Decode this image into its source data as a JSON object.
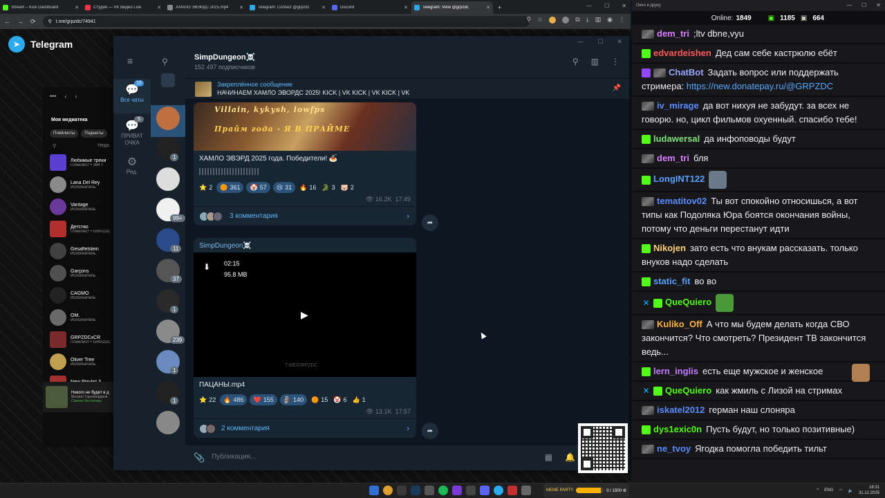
{
  "browser": {
    "tabs": [
      {
        "title": "Stream – Kick Dashboard",
        "color": "#53fc18"
      },
      {
        "title": "Студия — VK Видео Live",
        "color": "#ff3347"
      },
      {
        "title": "ХАМЛО ЭВЭРДС 2025.mp4",
        "color": "#888888"
      },
      {
        "title": "Telegram: Contact @grpzdc",
        "color": "#2aabee"
      },
      {
        "title": "Discord",
        "color": "#5865f2"
      },
      {
        "title": "Telegram: View @grpzdc",
        "color": "#2aabee"
      }
    ],
    "url": "t.me/grpzdc/74941",
    "new_tab": "+"
  },
  "tgweb": {
    "title": "Telegram",
    "library_title": "Моя медиатека",
    "chips": [
      "Плейлисты",
      "Подкасты"
    ],
    "search_hint": "Неда",
    "playlists": [
      {
        "name": "Любимые треки",
        "sub": "Плейлист • 364 т",
        "color": "#5a3fd0"
      },
      {
        "name": "Lana Del Rey",
        "sub": "Исполнитель",
        "color": "#8a8a8a"
      },
      {
        "name": "Vantage",
        "sub": "Исполнитель",
        "color": "#6a3a9a"
      },
      {
        "name": "Детство",
        "sub": "Плейлист • GRPZDC",
        "color": "#b03030"
      },
      {
        "name": "Gesaffelstein",
        "sub": "Исполнитель",
        "color": "#404040"
      },
      {
        "name": "Garçons",
        "sub": "Исполнитель",
        "color": "#505050"
      },
      {
        "name": "CAGMO",
        "sub": "Исполнитель",
        "color": "#222222"
      },
      {
        "name": "OM.",
        "sub": "Исполнитель",
        "color": "#6a6a6a"
      },
      {
        "name": "GRPZDCxCR",
        "sub": "Плейлист • GRPZDC",
        "color": "#7a2a2a"
      },
      {
        "name": "Oliver Tree",
        "sub": "Исполнитель",
        "color": "#c0a050"
      },
      {
        "name": "New Playlist 3",
        "sub": "Плейлист • GRPZDC",
        "color": "#a03030"
      }
    ],
    "player": {
      "title": "Никого не будет в д",
      "artist": "Михаил Тарнавердиев",
      "note": "Сжатие без потерь"
    }
  },
  "tg": {
    "folders": [
      {
        "label": "Все чаты",
        "badge": "15"
      },
      {
        "label": "ПРИВАТ ОЧКА",
        "badge": "5"
      },
      {
        "label": "Ред.",
        "badge": ""
      }
    ],
    "chat_badges": [
      "1",
      "99+",
      "11",
      "37",
      "1",
      "239",
      "1",
      "1"
    ],
    "channel_name": "SimpDungeon☠️",
    "subscribers": "152 497 подписчиков",
    "pinned_label": "Закреплённое сообщение",
    "pinned_text": "НАЧИНАЕМ ХАМЛО ЭВОРДС 2025!  KICK | VK KICK | VK KICK | VK",
    "post1": {
      "image_line1": "Villain, kykysh, lowfps",
      "image_line2": "Прайм года - Я В ПРАЙМЕ",
      "text": "ХАМЛО ЭВЭРД 2025 года. Победители! 🍝",
      "reactions": [
        {
          "e": "⭐",
          "n": "2",
          "plain": true
        },
        {
          "e": "🟠",
          "n": "361"
        },
        {
          "e": "🤡",
          "n": "57"
        },
        {
          "e": "😢",
          "n": "31"
        },
        {
          "e": "🔥",
          "n": "16",
          "plain": true
        },
        {
          "e": "🐊",
          "n": "3",
          "plain": true
        },
        {
          "e": "🐷",
          "n": "2",
          "plain": true
        }
      ],
      "views": "👁 16.2K",
      "time": "17:49",
      "comments": "3 комментария"
    },
    "post2": {
      "sender": "SimpDungeon☠️",
      "duration": "02:15",
      "size": "95.8 MB",
      "watermark": "T.ME/GRPZDC",
      "text": "ПАЦАНЫ.mp4",
      "reactions": [
        {
          "e": "⭐",
          "n": "22",
          "plain": true
        },
        {
          "e": "🔥",
          "n": "486"
        },
        {
          "e": "❤️",
          "n": "155"
        },
        {
          "e": "🗿",
          "n": "140"
        },
        {
          "e": "🟠",
          "n": "15",
          "plain": true
        },
        {
          "e": "🤡",
          "n": "6",
          "plain": true
        },
        {
          "e": "👍",
          "n": "1",
          "plain": true
        }
      ],
      "views": "👁 13.1K",
      "time": "17:57",
      "comments": "2 комментария"
    },
    "composer_placeholder": "Публикация..."
  },
  "chatwin": {
    "title": "Окно в друку",
    "online_label": "Online:",
    "online": "1849",
    "followers": "1185",
    "subs": "664",
    "messages": [
      {
        "badges": [
          "sub"
        ],
        "user": "dem_tri",
        "color": "#d97cff",
        "text": ";ltv dbne,vyu"
      },
      {
        "badges": [
          "k"
        ],
        "user": "edvardeishen",
        "color": "#ff5a5a",
        "text": "Дед сам себе кастрюлю ебёт"
      },
      {
        "badges": [
          "bot",
          "sub"
        ],
        "user": "ChatBot",
        "color": "#9aa4ff",
        "text": "Задать вопрос или поддержать стримера: ",
        "link": "https://new.donatepay.ru/@GRPZDC"
      },
      {
        "badges": [
          "sub"
        ],
        "user": "iv_mirage",
        "color": "#5a8cff",
        "text": "да вот нихуя не забудут. за всех не говорю. но, цикл фильмов охуенный. спасибо тебе!"
      },
      {
        "badges": [
          "k"
        ],
        "user": "ludawersal",
        "color": "#7fe07f",
        "text": "да инфоповоды будут"
      },
      {
        "badges": [
          "sub"
        ],
        "user": "dem_tri",
        "color": "#d97cff",
        "text": "бля"
      },
      {
        "badges": [
          "k"
        ],
        "user": "LongINT122",
        "color": "#5aa0ff",
        "text": "",
        "emote": "#6a7a8a"
      },
      {
        "badges": [
          "sub"
        ],
        "user": "tematitov02",
        "color": "#5a8cff",
        "text": "Ты вот спокойно относишься, а вот типы как Подоляка Юра боятся окончания войны, потому что деньги перестанут идти"
      },
      {
        "badges": [
          "k"
        ],
        "user": "Nikojen",
        "color": "#ffd27a",
        "text": "зато есть что внукам рассказать. только внуков надо сделать"
      },
      {
        "badges": [
          "k"
        ],
        "user": "static_fit",
        "color": "#5aa0ff",
        "text": "во во"
      },
      {
        "badges": [
          "mod",
          "k"
        ],
        "user": "QueQuiero",
        "color": "#53fc18",
        "text": "",
        "emote": "#4a9a3a"
      },
      {
        "badges": [
          "sub"
        ],
        "user": "Kuliko_Off",
        "color": "#ffb347",
        "text": "А что мы будем делать когда СВО закончится? Что смотреть? Президент ТВ закончится ведь..."
      },
      {
        "badges": [
          "k"
        ],
        "user": "lern_inglis",
        "color": "#c27bff",
        "text": "есть еще мужское и женское",
        "emote_end": "#b08050"
      },
      {
        "badges": [
          "mod",
          "k"
        ],
        "user": "QueQuiero",
        "color": "#53fc18",
        "text": "как жмиль с Лизой на стримах"
      },
      {
        "badges": [
          "sub"
        ],
        "user": "iskatel2012",
        "color": "#5a8cff",
        "text": "герман наш слоняра"
      },
      {
        "badges": [
          "k"
        ],
        "user": "dys1exic0n",
        "color": "#53fc18",
        "text": "Пусть будут, но только позитивные)"
      },
      {
        "badges": [
          "sub"
        ],
        "user": "ne_tvoy",
        "color": "#5a8cff",
        "text": "Ягодка помогла победить тильт"
      }
    ]
  },
  "taskbar": {
    "meme_label": "MEME PARTY",
    "meme_value": "0 / 1500 ⚙",
    "meme_progress": 0.9,
    "lang": "ENG",
    "time": "18:31",
    "date": "31.12.2025"
  },
  "colors": {
    "tg_bg": "#0e1621",
    "tg_panel": "#17212b",
    "tg_accent": "#5eb5f7",
    "kick_green": "#53fc18"
  }
}
